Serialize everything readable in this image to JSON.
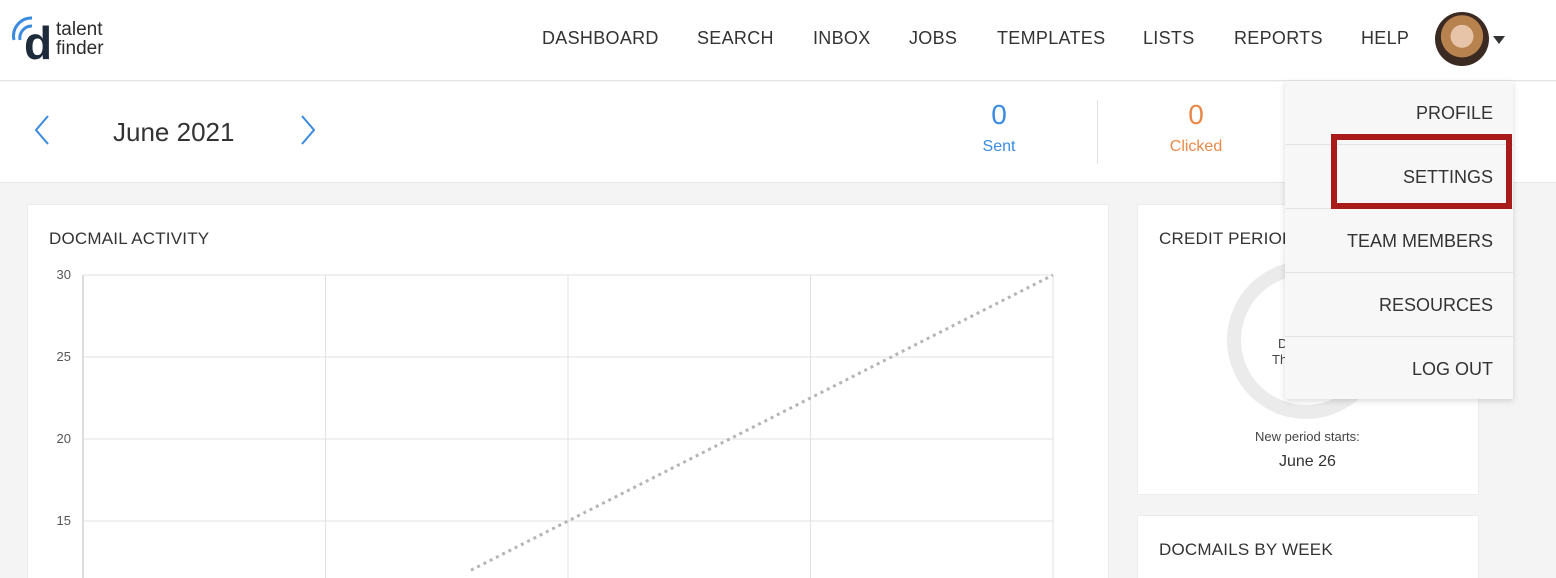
{
  "brand": {
    "line1": "talent",
    "line2": "finder",
    "letter": "d",
    "arc_color": "#3a8be0"
  },
  "nav": {
    "items": [
      {
        "label": "DASHBOARD"
      },
      {
        "label": "SEARCH"
      },
      {
        "label": "INBOX"
      },
      {
        "label": "JOBS"
      },
      {
        "label": "TEMPLATES"
      },
      {
        "label": "LISTS"
      },
      {
        "label": "REPORTS"
      },
      {
        "label": "HELP"
      }
    ]
  },
  "month": {
    "title": "June 2021",
    "prev_icon": "chevron-left-icon",
    "next_icon": "chevron-right-icon"
  },
  "stats": [
    {
      "value": "0",
      "label": "Sent",
      "color": "#3a8be0"
    },
    {
      "value": "0",
      "label": "Clicked",
      "color": "#e8894a"
    }
  ],
  "activity_card": {
    "title": "DOCMAIL ACTIVITY"
  },
  "credit_card": {
    "title": "CREDIT PERIOD",
    "donut_line1": "D",
    "donut_line2": "Th",
    "new_period_label": "New period starts:",
    "new_period_date": "June 26"
  },
  "weekly_card": {
    "title": "DOCMAILS BY WEEK"
  },
  "dropdown": {
    "items": [
      {
        "label": "PROFILE"
      },
      {
        "label": "SETTINGS"
      },
      {
        "label": "TEAM MEMBERS"
      },
      {
        "label": "RESOURCES"
      },
      {
        "label": "LOG OUT"
      }
    ],
    "highlight_color": "#a91b1b"
  },
  "chart_data": {
    "type": "line",
    "title": "DOCMAIL ACTIVITY",
    "y_ticks": [
      30,
      25,
      20,
      15
    ],
    "ylim_visible": [
      12,
      30
    ],
    "grid": true,
    "series": [
      {
        "style": "dotted",
        "color": "#b5b5b5",
        "points": [
          [
            1.6,
            12
          ],
          [
            2,
            15
          ],
          [
            3,
            22.5
          ],
          [
            4,
            30
          ]
        ]
      }
    ],
    "x_gridlines": 5
  }
}
